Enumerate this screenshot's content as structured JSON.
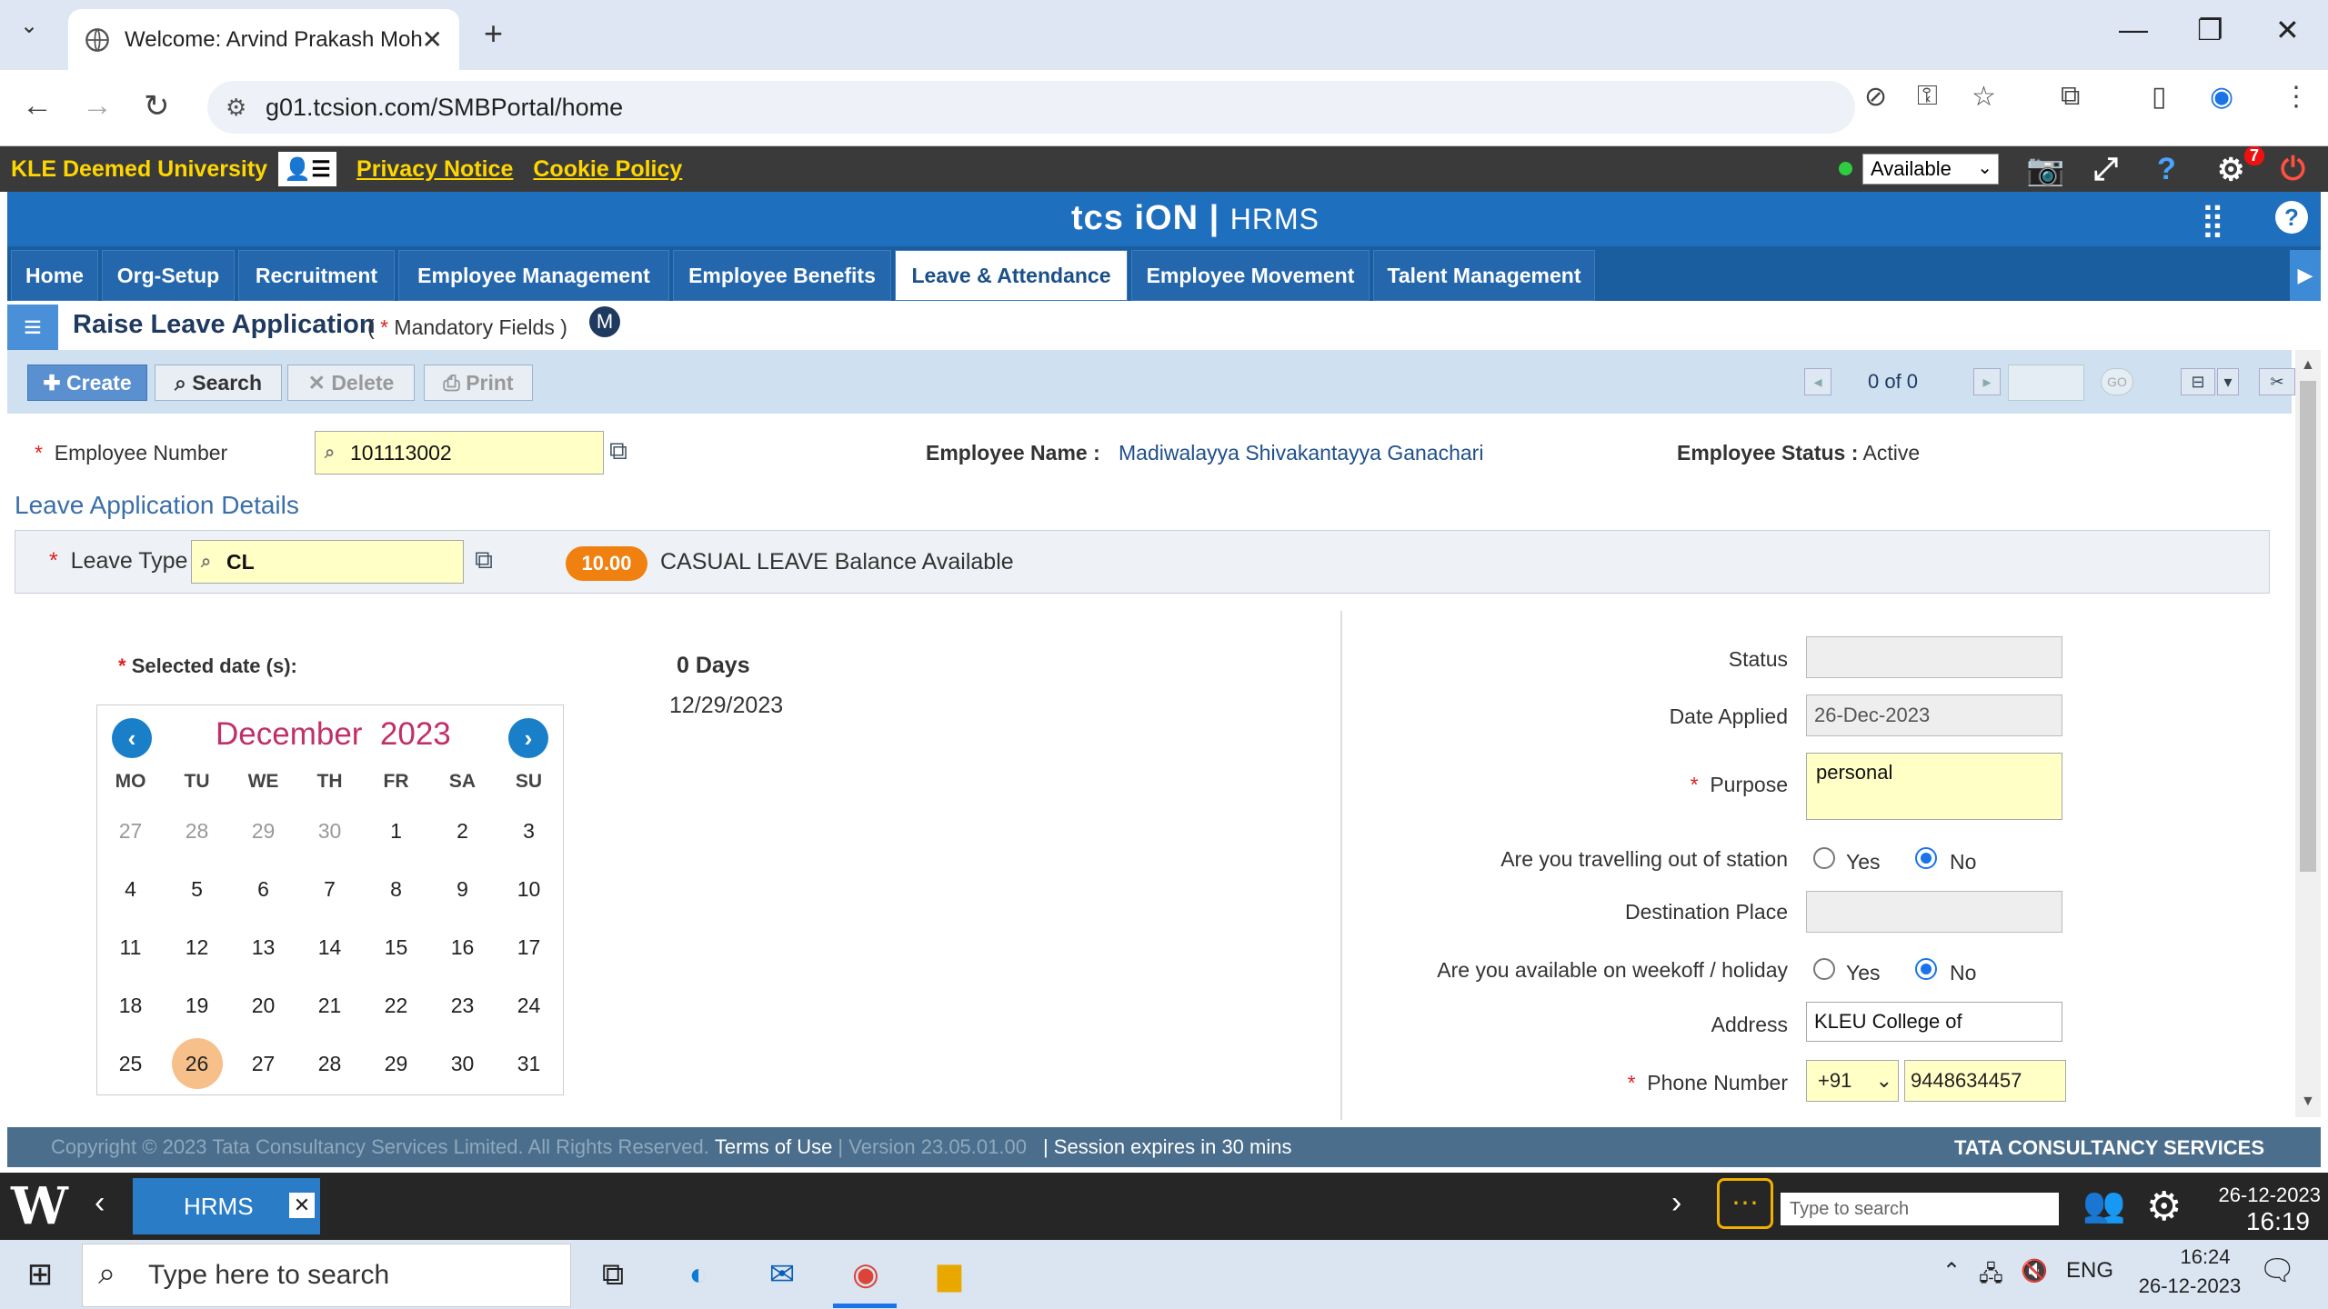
{
  "browser": {
    "tab_title": "Welcome: Arvind Prakash Mohi",
    "url": "g01.tcsion.com/SMBPortal/home"
  },
  "appbar": {
    "university": "KLE Deemed University",
    "privacy": "Privacy Notice",
    "cookie": "Cookie Policy",
    "availability": "Available",
    "notif_count": "7"
  },
  "header": {
    "logo": "tcs iON",
    "product": "HRMS"
  },
  "nav": {
    "tabs": [
      "Home",
      "Org-Setup",
      "Recruitment",
      "Employee Management",
      "Employee Benefits",
      "Leave & Attendance",
      "Employee Movement",
      "Talent Management"
    ],
    "active": "Leave & Attendance"
  },
  "page": {
    "title": "Raise Leave Application",
    "mandatory_prefix": "(",
    "mandatory": "Mandatory Fields )"
  },
  "toolbar": {
    "create": "Create",
    "search": "Search",
    "delete": "Delete",
    "print": "Print",
    "pager": "0 of 0",
    "go": "GO"
  },
  "employee": {
    "number_label": "Employee Number",
    "number": "101113002",
    "name_label": "Employee Name :",
    "name": "Madiwalayya Shivakantayya Ganachari",
    "status_label": "Employee Status :",
    "status": "Active"
  },
  "leave": {
    "section": "Leave Application Details",
    "type_label": "Leave Type",
    "type": "CL",
    "balance": "10.00",
    "balance_text": "CASUAL LEAVE Balance Available",
    "selected_label": "Selected date (s):",
    "days": "0 Days",
    "date": "12/29/2023"
  },
  "calendar": {
    "month": "December",
    "year": "2023",
    "weekdays": [
      "MO",
      "TU",
      "WE",
      "TH",
      "FR",
      "SA",
      "SU"
    ],
    "weeks": [
      [
        "27",
        "28",
        "29",
        "30",
        "1",
        "2",
        "3"
      ],
      [
        "4",
        "5",
        "6",
        "7",
        "8",
        "9",
        "10"
      ],
      [
        "11",
        "12",
        "13",
        "14",
        "15",
        "16",
        "17"
      ],
      [
        "18",
        "19",
        "20",
        "21",
        "22",
        "23",
        "24"
      ],
      [
        "25",
        "26",
        "27",
        "28",
        "29",
        "30",
        "31"
      ]
    ],
    "today": "26"
  },
  "form": {
    "status_label": "Status",
    "status": "",
    "date_applied_label": "Date Applied",
    "date_applied": "26-Dec-2023",
    "purpose_label": "Purpose",
    "purpose": "personal",
    "travel_label": "Are you travelling out of station",
    "yes": "Yes",
    "no": "No",
    "destination_label": "Destination Place",
    "destination": "",
    "weekoff_label": "Are you available on weekoff / holiday",
    "address_label": "Address",
    "address": "KLEU College of",
    "phone_label": "Phone Number",
    "phone_code": "+91",
    "phone": "9448634457"
  },
  "footer": {
    "copyright": "Copyright © 2023 Tata Consultancy Services Limited. All Rights Reserved.",
    "terms": "Terms of Use",
    "version": "| Version 23.05.01.00",
    "session": "| Session expires in 30 mins",
    "brand": "TATA CONSULTANCY SERVICES"
  },
  "apptaskbar": {
    "tab": "HRMS",
    "search_placeholder": "Type to search",
    "date": "26-12-2023",
    "time": "16:19"
  },
  "wintaskbar": {
    "search": "Type here to search",
    "lang": "ENG",
    "time": "16:24",
    "date": "26-12-2023"
  }
}
